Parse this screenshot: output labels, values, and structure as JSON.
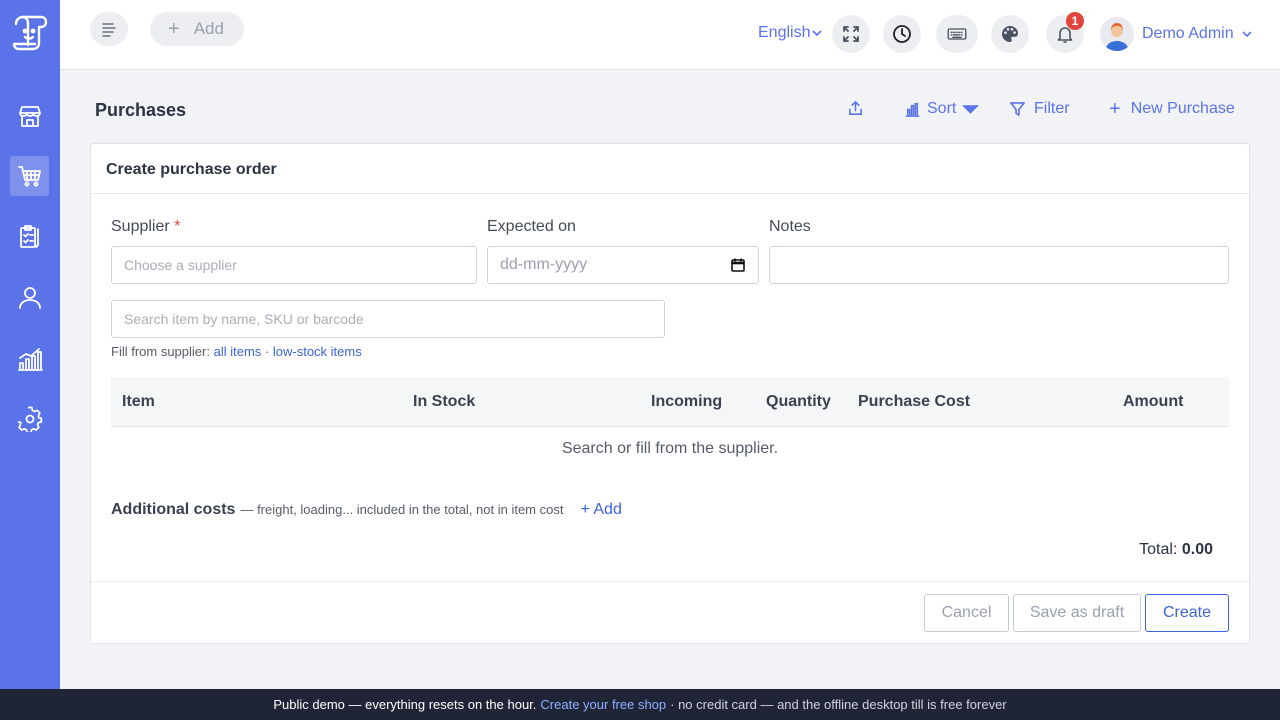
{
  "topbar": {
    "add_label": "Add",
    "language": "English",
    "notification_count": "1",
    "user_name": "Demo Admin"
  },
  "page": {
    "title": "Purchases",
    "actions": {
      "sort": "Sort",
      "filter": "Filter",
      "new_purchase": "New Purchase"
    }
  },
  "form": {
    "card_title": "Create purchase order",
    "supplier_label": "Supplier",
    "supplier_required": "*",
    "supplier_placeholder": "Choose a supplier",
    "expected_label": "Expected on",
    "expected_placeholder": "dd-mm-yyyy",
    "notes_label": "Notes",
    "notes_value": "",
    "search_placeholder": "Search item by name, SKU or barcode",
    "fill_prefix": "Fill from supplier:",
    "fill_all": "all items",
    "fill_sep": "·",
    "fill_low": "low-stock items"
  },
  "table": {
    "columns": [
      "Item",
      "In Stock",
      "Incoming",
      "Quantity",
      "Purchase Cost",
      "Amount"
    ],
    "empty_message": "Search or fill from the supplier."
  },
  "additional_costs": {
    "title": "Additional costs",
    "hint": "— freight, loading... included in the total, not in item cost",
    "add_label": "+ Add"
  },
  "totals": {
    "label": "Total:",
    "value": "0.00"
  },
  "buttons": {
    "cancel": "Cancel",
    "save_draft": "Save as draft",
    "create": "Create"
  },
  "banner": {
    "text1": "Public demo — everything resets on the hour.",
    "link": "Create your free shop",
    "text2": "· no credit card — and the offline desktop till is free forever"
  },
  "colors": {
    "sidebar": "#5b73e8",
    "accent": "#3d63d8",
    "banner": "#1f2537",
    "badge": "#e0463d"
  },
  "icons": {
    "sidebar": [
      "store-icon",
      "cart-icon",
      "clipboard-icon",
      "user-icon",
      "chart-icon",
      "gear-icon"
    ],
    "topbar": [
      "menu-icon",
      "fullscreen-icon",
      "clock-icon",
      "keyboard-icon",
      "palette-icon",
      "bell-icon"
    ]
  }
}
